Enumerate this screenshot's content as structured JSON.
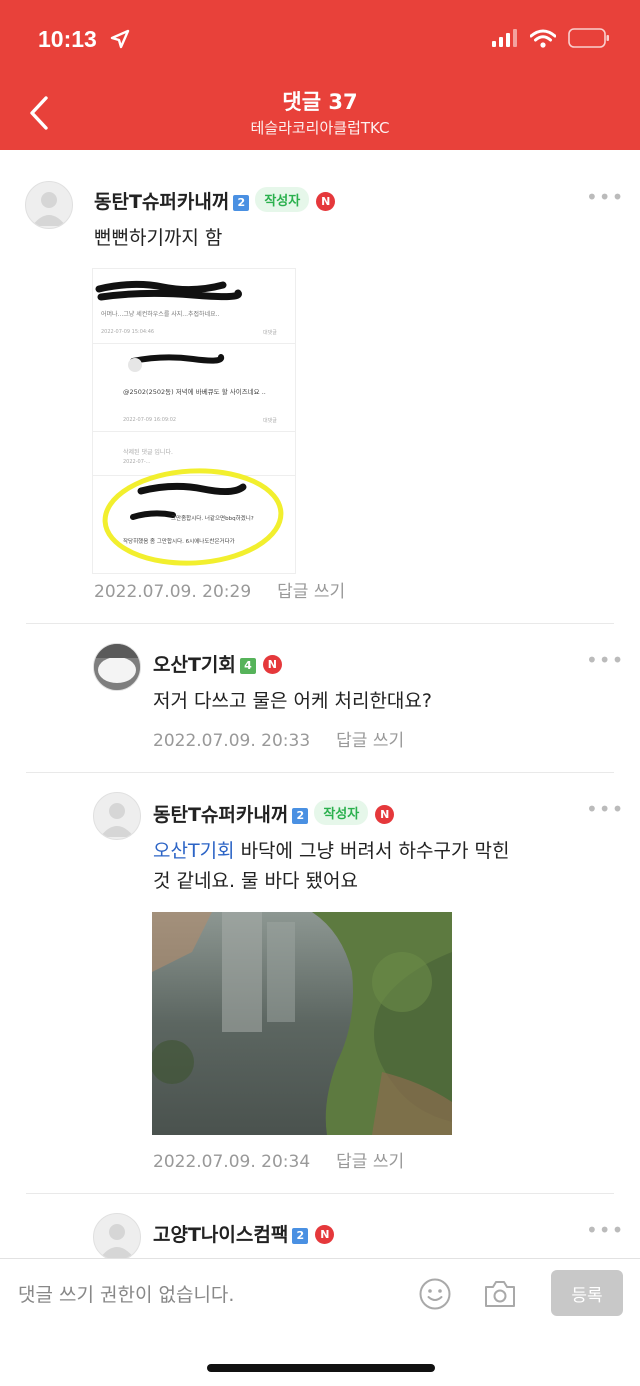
{
  "status": {
    "time": "10:13"
  },
  "header": {
    "title": "댓글 37",
    "subtitle": "테슬라코리아클럽TKC"
  },
  "comments": [
    {
      "name": "동탄T슈퍼카내꺼",
      "level": "2",
      "level_color": "#4a90e2",
      "author_badge": "작성자",
      "n_badge": "N",
      "text": "뻔뻔하기까지 함",
      "date": "2022.07.09. 20:29",
      "reply": "답글 쓰기",
      "screenshot": {
        "line1": "어머나...그냥 세컨하우스를 사지...추접하네요..",
        "date1": "2022-07-09 15:04:46",
        "reply1": "대댓글",
        "mention2": "@2502(2502동) 저녁에 바베큐도 할 사이즈네요 ..",
        "date2": "2022-07-09 16:09:02",
        "reply2": "대댓글",
        "deleted": "삭제된 댓글 입니다.",
        "date3": "2022-07-...",
        "line4a": "그만좀합시다. 너같으면bbq하겠니?",
        "line4b": "작당히했음 좀 그만합시다. 6시에나도찬은거다가"
      }
    },
    {
      "name": "오산T기회",
      "level": "4",
      "level_color": "#56b35a",
      "n_badge": "N",
      "text": "저거 다쓰고 물은 어케 처리한대요?",
      "date": "2022.07.09. 20:33",
      "reply": "답글 쓰기"
    },
    {
      "name": "동탄T슈퍼카내꺼",
      "level": "2",
      "level_color": "#4a90e2",
      "author_badge": "작성자",
      "n_badge": "N",
      "mention": "오산T기회",
      "text_line1": " 바닥에 그냥 버려서 하수구가 막힌",
      "text_line2": "것 같네요. 물 바다 됐어요",
      "date": "2022.07.09. 20:34",
      "reply": "답글 쓰기"
    },
    {
      "name": "고양T나이스컴팩",
      "level": "2",
      "level_color": "#4a90e2",
      "n_badge": "N"
    }
  ],
  "bottom": {
    "placeholder": "댓글 쓰기 권한이 없습니다.",
    "submit_label": "등록"
  },
  "icons": {
    "back": "back-chevron-icon",
    "location": "location-arrow-icon",
    "smile": "smile-icon",
    "camera": "camera-icon",
    "more": "more-dots-icon"
  },
  "colors": {
    "brand": "#e8413a",
    "author_green": "#2ab04d",
    "mention_blue": "#2c64c6"
  }
}
